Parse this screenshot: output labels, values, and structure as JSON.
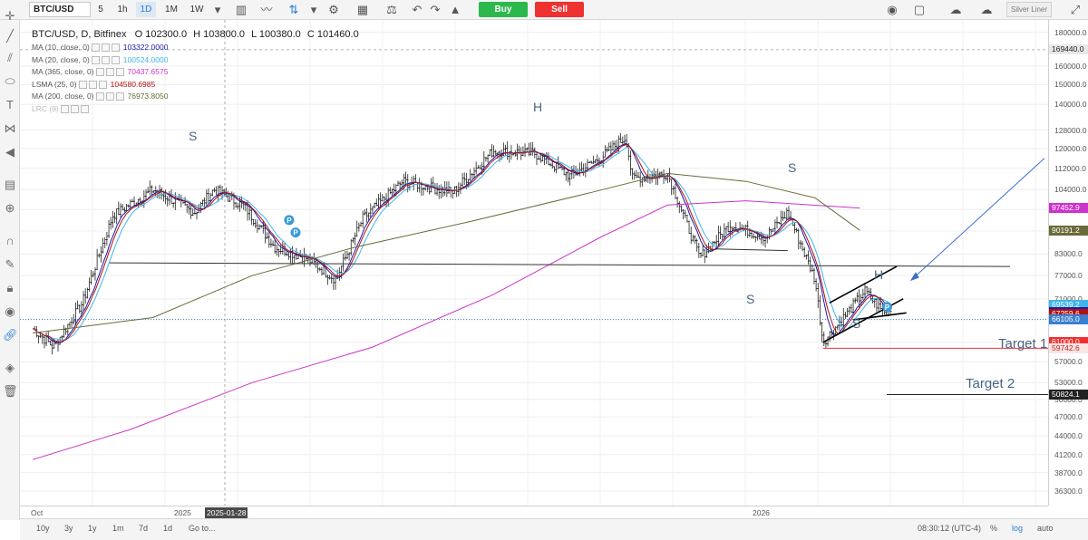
{
  "toolbar": {
    "symbol": "BTC/USD",
    "timeframes": [
      "5",
      "1h",
      "1D",
      "1M",
      "1W"
    ],
    "active_timeframe": "1D",
    "buy_label": "Buy",
    "sell_label": "Sell",
    "theme_label": "Silver Liner"
  },
  "legend": {
    "title": "BTC/USD, D, Bitfinex",
    "ohlc": {
      "o": "O 102300.0",
      "h": "H 103800.0",
      "l": "L 100380.0",
      "c": "C 101460.0"
    },
    "indicators": [
      {
        "label": "MA (10, close, 0)",
        "value": "103322.0000",
        "color": "#1a1aa8"
      },
      {
        "label": "MA (20, close, 0)",
        "value": "100524.0000",
        "color": "#3fb6e8"
      },
      {
        "label": "MA (365, close, 0)",
        "value": "70437.6575",
        "color": "#cc33cc"
      },
      {
        "label": "LSMA (25, 0)",
        "value": "104580.6985",
        "color": "#b01010"
      },
      {
        "label": "MA (200, close, 0)",
        "value": "76973.8050",
        "color": "#6a6a3a"
      },
      {
        "label": "LRC (9)",
        "value": "",
        "color": "#9999cc"
      }
    ]
  },
  "chart_data": {
    "type": "candlestick",
    "title": "BTC/USD, D, Bitfinex",
    "y_scale": "log",
    "ylim": [
      34500,
      188000
    ],
    "price_ticks": [
      180000,
      160000,
      150000,
      140000,
      128000,
      120000,
      112000,
      104000,
      97000,
      90000,
      83000,
      77000,
      71000,
      66000,
      61000,
      57000,
      53000,
      50000,
      47000,
      44000,
      41200,
      38700,
      36300
    ],
    "x_ticks": [
      "Oct",
      "2025",
      "2025-01-28",
      "2026"
    ],
    "price_path": [
      {
        "t": "2024-10-01",
        "price": 64000
      },
      {
        "t": "2024-10-14",
        "price": 60000
      },
      {
        "t": "2024-11-01",
        "price": 70000
      },
      {
        "t": "2024-11-20",
        "price": 95000
      },
      {
        "t": "2024-12-15",
        "price": 104000
      },
      {
        "t": "2025-01-10",
        "price": 96000
      },
      {
        "t": "2025-01-22",
        "price": 104000
      },
      {
        "t": "2025-02-10",
        "price": 98000
      },
      {
        "t": "2025-03-01",
        "price": 85000
      },
      {
        "t": "2025-03-20",
        "price": 82000
      },
      {
        "t": "2025-04-08",
        "price": 76000
      },
      {
        "t": "2025-04-25",
        "price": 94000
      },
      {
        "t": "2025-05-20",
        "price": 107000
      },
      {
        "t": "2025-06-20",
        "price": 103000
      },
      {
        "t": "2025-07-15",
        "price": 119000
      },
      {
        "t": "2025-08-10",
        "price": 118000
      },
      {
        "t": "2025-09-01",
        "price": 109000
      },
      {
        "t": "2025-09-20",
        "price": 116000
      },
      {
        "t": "2025-10-06",
        "price": 125000
      },
      {
        "t": "2025-10-10",
        "price": 108000
      },
      {
        "t": "2025-11-01",
        "price": 110000
      },
      {
        "t": "2025-11-21",
        "price": 82000
      },
      {
        "t": "2025-12-10",
        "price": 92000
      },
      {
        "t": "2026-01-01",
        "price": 88000
      },
      {
        "t": "2026-01-15",
        "price": 96000
      },
      {
        "t": "2026-02-01",
        "price": 76000
      },
      {
        "t": "2026-02-06",
        "price": 61000
      },
      {
        "t": "2026-02-20",
        "price": 67000
      },
      {
        "t": "2026-03-04",
        "price": 73000
      },
      {
        "t": "2026-03-15",
        "price": 68000
      },
      {
        "t": "2026-03-20",
        "price": 68100
      }
    ],
    "price_labels": [
      {
        "value": "169440.0",
        "price": 169440,
        "bg": "#e8e8e8",
        "fg": "#222"
      },
      {
        "value": "97452.9",
        "price": 97453,
        "bg": "#cc33cc",
        "fg": "#fff"
      },
      {
        "value": "90191.2",
        "price": 90191,
        "bg": "#6a6a3a",
        "fg": "#fff"
      },
      {
        "value": "69539.2",
        "price": 69539,
        "bg": "#3fb6e8",
        "fg": "#fff"
      },
      {
        "value": "67863.7",
        "price": 67864,
        "bg": "#1a1aa8",
        "fg": "#fff"
      },
      {
        "value": "67259.6",
        "price": 67260,
        "bg": "#b01010",
        "fg": "#fff"
      },
      {
        "value": "66105.0",
        "price": 66105,
        "bg": "#3a7fd0",
        "fg": "#fff"
      },
      {
        "value": "61000.0",
        "price": 61000,
        "bg": "#ee3232",
        "fg": "#fff"
      },
      {
        "value": "59742.6",
        "price": 59743,
        "bg": "#fbe5e5",
        "fg": "#c02020"
      },
      {
        "value": "50824.1",
        "price": 50824,
        "bg": "#222222",
        "fg": "#fff"
      }
    ],
    "annotations": [
      "S",
      "H",
      "S",
      "S",
      "H",
      "S",
      "Target 1",
      "Target 2"
    ],
    "colors": {
      "up": "#222222",
      "down": "#222222",
      "neckline": "#333333",
      "target": "#ee3232"
    }
  },
  "bottombar": {
    "ranges": [
      "10y",
      "3y",
      "1y",
      "1m",
      "7d",
      "1d"
    ],
    "goto": "Go to...",
    "time": "08:30:12 (UTC-4)",
    "percent": "%",
    "log": "log",
    "auto": "auto"
  }
}
